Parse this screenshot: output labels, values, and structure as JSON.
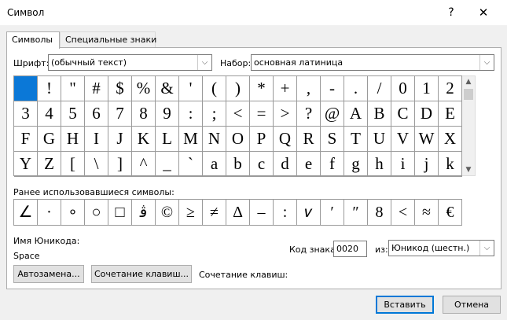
{
  "window": {
    "title": "Символ",
    "help": "?",
    "close": "✕"
  },
  "tabs": [
    {
      "label": "Символы"
    },
    {
      "label": "Специальные знаки"
    }
  ],
  "font": {
    "label": "Шрифт:",
    "value": "(обычный текст)"
  },
  "subset": {
    "label": "Набор:",
    "value": "основная латиница"
  },
  "symbols": [
    [
      " ",
      "!",
      "\"",
      "#",
      "$",
      "%",
      "&",
      "'",
      "(",
      ")",
      "*",
      "+",
      ",",
      "-",
      ".",
      "/",
      "0",
      "1",
      "2"
    ],
    [
      "3",
      "4",
      "5",
      "6",
      "7",
      "8",
      "9",
      ":",
      ";",
      "<",
      "=",
      ">",
      "?",
      "@",
      "A",
      "B",
      "C",
      "D",
      "E"
    ],
    [
      "F",
      "G",
      "H",
      "I",
      "J",
      "K",
      "L",
      "M",
      "N",
      "O",
      "P",
      "Q",
      "R",
      "S",
      "T",
      "U",
      "V",
      "W",
      "X"
    ],
    [
      "Y",
      "Z",
      "[",
      "\\",
      "]",
      "^",
      "_",
      "`",
      "a",
      "b",
      "c",
      "d",
      "e",
      "f",
      "g",
      "h",
      "i",
      "j",
      "k"
    ]
  ],
  "selected_symbol_index": 0,
  "recent": {
    "label": "Ранее использовавшиеся символы:",
    "items": [
      "∠",
      "·",
      "∘",
      "○",
      "□",
      "ﭬ",
      "©",
      "≥",
      "≠",
      "Δ",
      "–",
      ":",
      "𝑣",
      "′",
      "″",
      "8",
      "<",
      "≈",
      "€"
    ]
  },
  "unicode_name": {
    "label": "Имя Юникода:",
    "value": "Space"
  },
  "char_code": {
    "label": "Код знака:",
    "value": "0020"
  },
  "from": {
    "label": "из:",
    "value": "Юникод (шестн.)"
  },
  "buttons": {
    "autocorrect": "Автозамена...",
    "shortcut_key": "Сочетание клавиш...",
    "shortcut_label": "Сочетание клавиш:",
    "insert": "Вставить",
    "cancel": "Отмена"
  },
  "colors": {
    "selection": "#0b78d7",
    "accent": "#0078d7"
  }
}
